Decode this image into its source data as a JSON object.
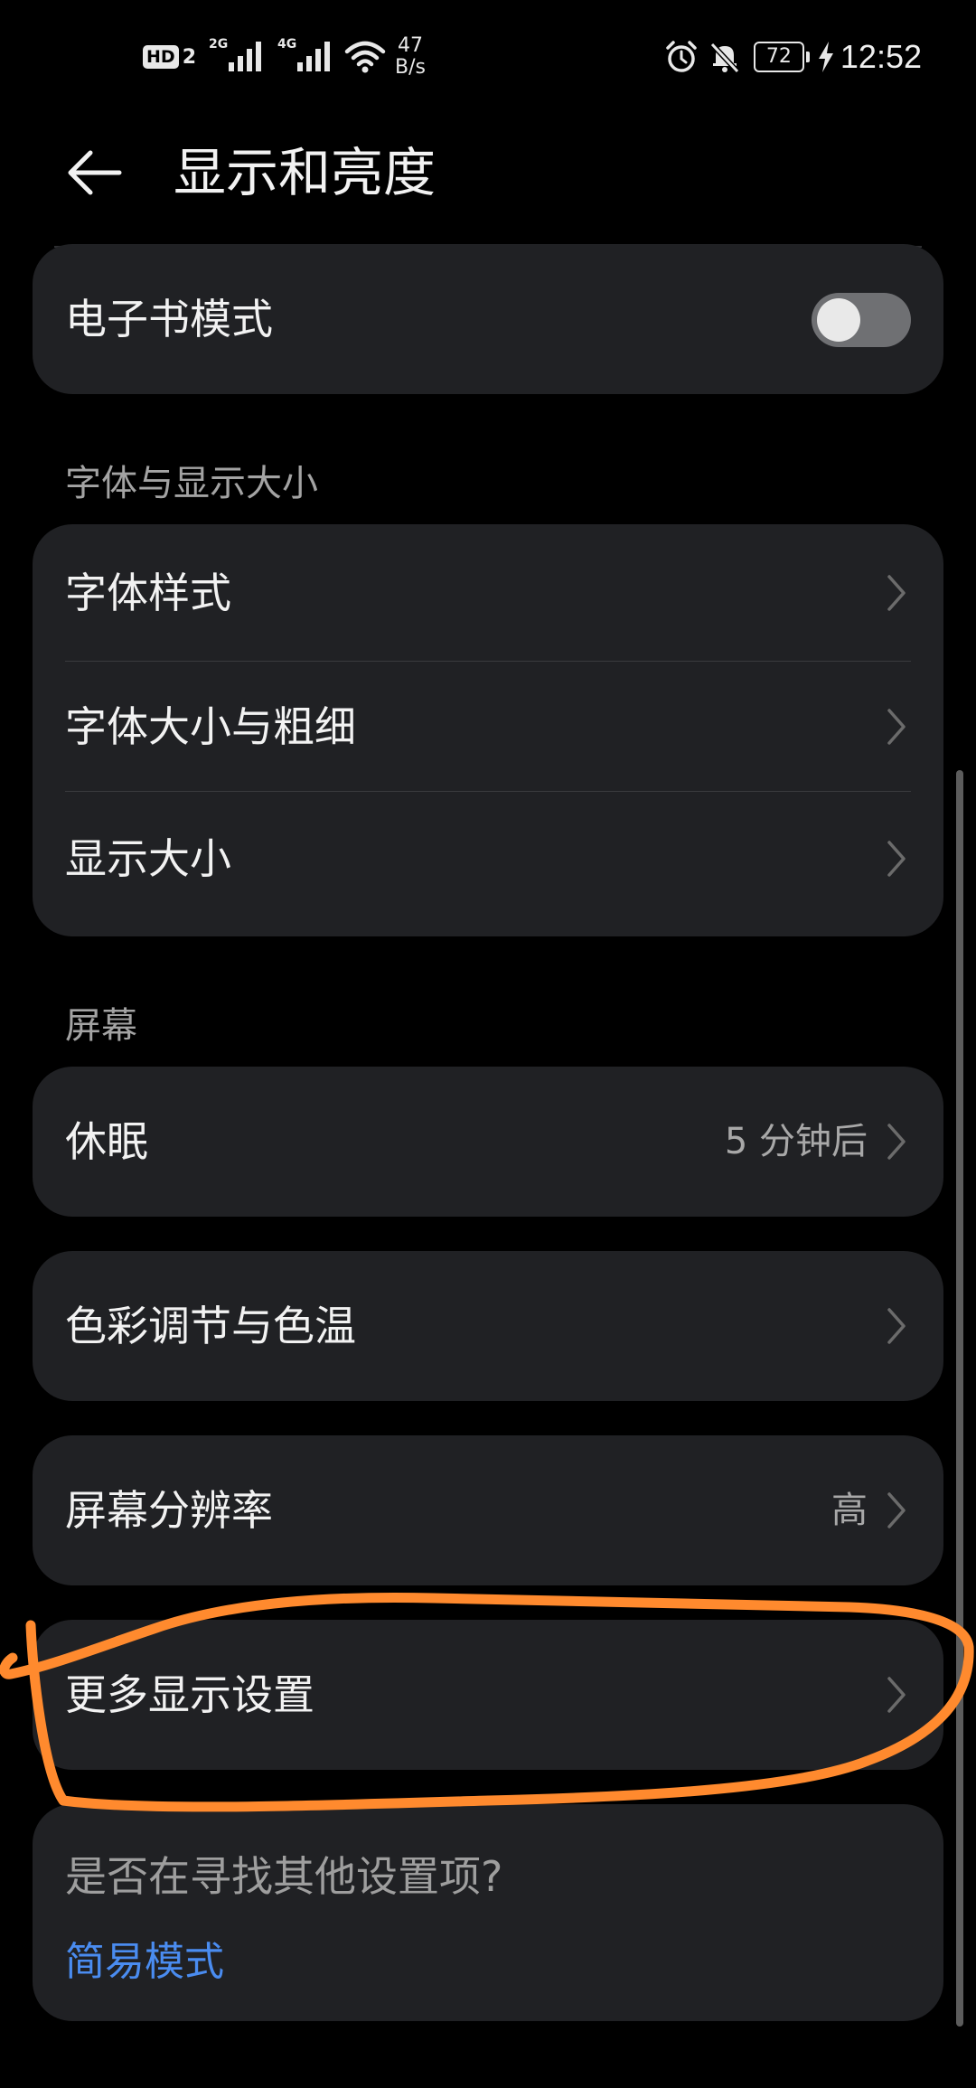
{
  "status_bar": {
    "hd": "HD",
    "hd_num": "2",
    "sim1_type": "2G",
    "sim2_type": "4G",
    "net_speed_value": "47",
    "net_speed_unit": "B/s",
    "battery": "72",
    "time": "12:52"
  },
  "header": {
    "title": "显示和亮度"
  },
  "ebook": {
    "label": "电子书模式",
    "toggle_on": false
  },
  "font_section": {
    "header": "字体与显示大小",
    "items": [
      {
        "label": "字体样式"
      },
      {
        "label": "字体大小与粗细"
      },
      {
        "label": "显示大小"
      }
    ]
  },
  "screen_section": {
    "header": "屏幕",
    "sleep": {
      "label": "休眠",
      "value": "5 分钟后"
    },
    "color": {
      "label": "色彩调节与色温"
    },
    "resolution": {
      "label": "屏幕分辨率",
      "value": "高"
    },
    "more": {
      "label": "更多显示设置"
    }
  },
  "footer": {
    "question": "是否在寻找其他设置项?",
    "link": "简易模式"
  },
  "colors": {
    "background": "#000000",
    "card": "#202124",
    "accent_link": "#4a8cf0",
    "annotation": "#ff8a2e"
  }
}
